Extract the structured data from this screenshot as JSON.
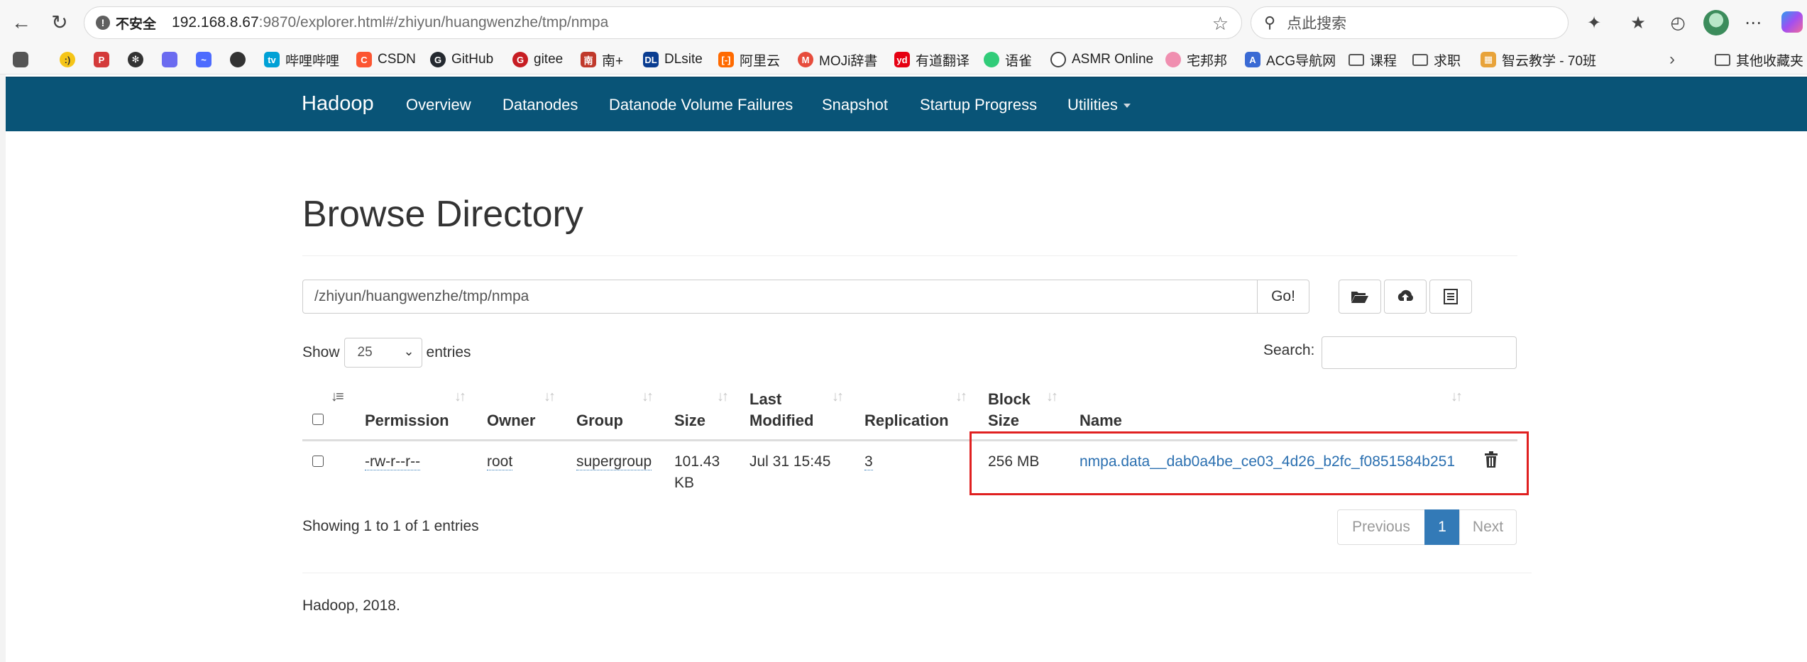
{
  "browser": {
    "address_warning": "不安全",
    "url_host": "192.168.8.67",
    "url_rest": ":9870/explorer.html#/zhiyun/huangwenzhe/tmp/nmpa",
    "search_placeholder": "点此搜索",
    "bookmarks": [
      {
        "label": "",
        "icon": "tab-icon",
        "color": "#555555"
      },
      {
        "label": "",
        "icon": "smiley-icon",
        "color": "#f5c518"
      },
      {
        "label": "",
        "icon": "pixiv-icon",
        "color": "#d43a3a"
      },
      {
        "label": "",
        "icon": "openai-icon",
        "color": "#333333"
      },
      {
        "label": "",
        "icon": "copilot-icon",
        "color": "#6b6bf0"
      },
      {
        "label": "",
        "icon": "deepseek-icon",
        "color": "#4d6bfe"
      },
      {
        "label": "",
        "icon": "github-user-icon",
        "color": "#333333"
      },
      {
        "label": "哔哩哔哩",
        "icon": "bilibili-icon",
        "color": "#00a1d6"
      },
      {
        "label": "CSDN",
        "icon": "csdn-icon",
        "color": "#fc5531"
      },
      {
        "label": "GitHub",
        "icon": "github-icon",
        "color": "#24292f"
      },
      {
        "label": "gitee",
        "icon": "gitee-icon",
        "color": "#c71d23"
      },
      {
        "label": "南+",
        "icon": "south-plus-icon",
        "color": "#c0392b"
      },
      {
        "label": "DLsite",
        "icon": "dlsite-icon",
        "color": "#0a3d91"
      },
      {
        "label": "阿里云",
        "icon": "aliyun-icon",
        "color": "#ff6a00"
      },
      {
        "label": "MOJi辞書",
        "icon": "moji-icon",
        "color": "#e74c3c"
      },
      {
        "label": "有道翻译",
        "icon": "youdao-icon",
        "color": "#e60012"
      },
      {
        "label": "语雀",
        "icon": "yuque-icon",
        "color": "#31cc79"
      },
      {
        "label": "ASMR Online",
        "icon": "globe-icon",
        "color": "#444444"
      },
      {
        "label": "宅邦邦",
        "icon": "zhaibangbang-icon",
        "color": "#f08fb0"
      },
      {
        "label": "ACG导航网",
        "icon": "acg-icon",
        "color": "#3a6ad4"
      },
      {
        "label": "课程",
        "icon": "folder-icon",
        "color": "#555555"
      },
      {
        "label": "求职",
        "icon": "folder-icon",
        "color": "#555555"
      },
      {
        "label": "智云教学 - 70班",
        "icon": "zhiyun-icon",
        "color": "#e8a33a"
      },
      {
        "label": "其他收藏夹",
        "icon": "folder-icon",
        "color": "#555555"
      }
    ]
  },
  "navbar": {
    "brand": "Hadoop",
    "links": [
      "Overview",
      "Datanodes",
      "Datanode Volume Failures",
      "Snapshot",
      "Startup Progress",
      "Utilities"
    ]
  },
  "page": {
    "title": "Browse Directory",
    "path": "/zhiyun/huangwenzhe/tmp/nmpa",
    "go_label": "Go!",
    "show_label": "Show",
    "page_length": "25",
    "entries_label": "entries",
    "search_label": "Search:",
    "columns": [
      "Permission",
      "Owner",
      "Group",
      "Size",
      "Last Modified",
      "Replication",
      "Block Size",
      "Name"
    ],
    "rows": [
      {
        "permission": "-rw-r--r--",
        "owner": "root",
        "group": "supergroup",
        "size": "101.43 KB",
        "last_modified": "Jul 31 15:45",
        "replication": "3",
        "block_size": "256 MB",
        "name": "nmpa.data__dab0a4be_ce03_4d26_b2fc_f0851584b251"
      }
    ],
    "info": "Showing 1 to 1 of 1 entries",
    "pagination": {
      "previous": "Previous",
      "current": "1",
      "next": "Next"
    },
    "footer": "Hadoop, 2018.",
    "colors": {
      "navbar": "#095477",
      "link": "#2a6fb0",
      "active_page": "#337ab7",
      "highlight": "#e02020"
    }
  }
}
